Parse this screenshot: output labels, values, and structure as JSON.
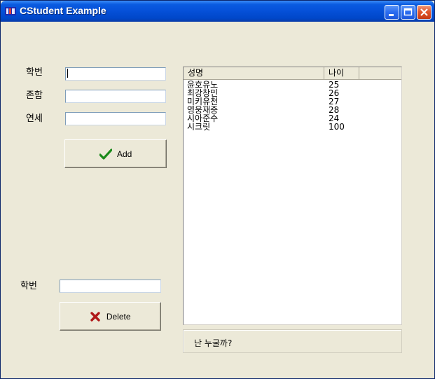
{
  "window": {
    "title": "CStudent Example"
  },
  "titlebar_buttons": {
    "minimize": "minimize-icon",
    "maximize": "maximize-icon",
    "close": "close-icon"
  },
  "form": {
    "student_id_label": "학번",
    "name_label": "존함",
    "age_label": "연세",
    "student_id_value": "",
    "name_value": "",
    "age_value": "",
    "add_button": "Add"
  },
  "delete_form": {
    "student_id_label": "학번",
    "student_id_value": "",
    "delete_button": "Delete"
  },
  "list": {
    "columns": [
      "성명",
      "나이",
      ""
    ],
    "rows": [
      {
        "name": "윤호유노",
        "age": "25"
      },
      {
        "name": "최강창민",
        "age": "26"
      },
      {
        "name": "미키유천",
        "age": "27"
      },
      {
        "name": "영웅재중",
        "age": "28"
      },
      {
        "name": "시아준수",
        "age": "24"
      },
      {
        "name": "시크릿",
        "age": "100"
      }
    ]
  },
  "status": {
    "text": "난 누굴까?"
  },
  "colors": {
    "titlebar": "#0550d8",
    "window_bg": "#ece9d8",
    "check_icon": "#1a8a1a",
    "x_icon": "#b01818"
  }
}
